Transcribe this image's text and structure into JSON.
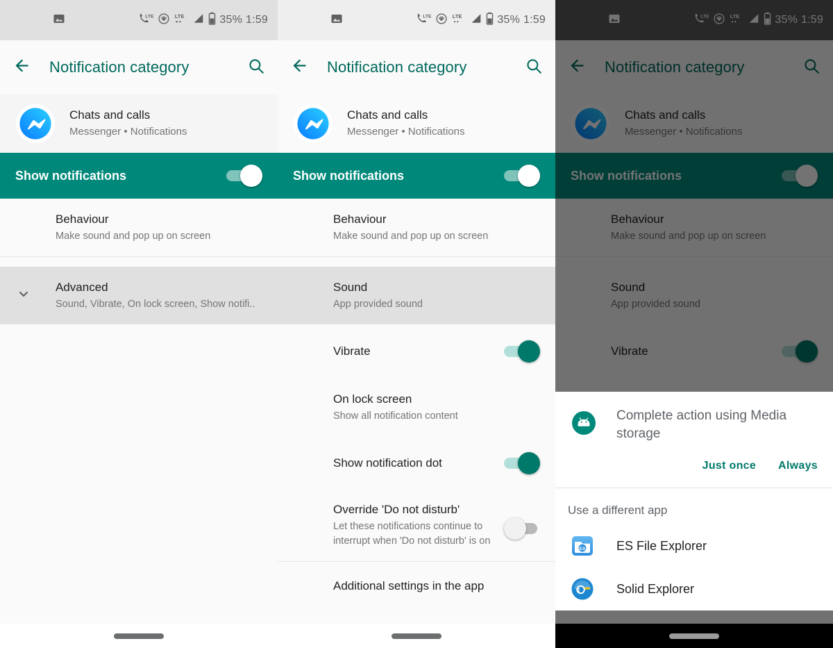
{
  "status_bar": {
    "icons": [
      "image-icon",
      "lte-call-icon",
      "hotspot-icon",
      "lte-data-icon",
      "signal-icon",
      "battery-icon"
    ],
    "battery": "35%",
    "time": "1:59"
  },
  "toolbar": {
    "title": "Notification category",
    "back_icon": "back-arrow-icon",
    "search_icon": "search-icon"
  },
  "app_header": {
    "icon": "messenger-icon",
    "title": "Chats and calls",
    "subtitle": "Messenger • Notifications"
  },
  "master_switch": {
    "label": "Show notifications",
    "state": "on"
  },
  "rows": {
    "behaviour": {
      "title": "Behaviour",
      "subtitle": "Make sound and pop up on screen"
    },
    "advanced": {
      "title": "Advanced",
      "subtitle": "Sound, Vibrate, On lock screen, Show notifi..",
      "chevron": "chevron-down-icon"
    },
    "sound": {
      "title": "Sound",
      "subtitle": "App provided sound"
    },
    "vibrate": {
      "title": "Vibrate",
      "state": "on"
    },
    "lock_screen": {
      "title": "On lock screen",
      "subtitle": "Show all notification content"
    },
    "notification_dot": {
      "title": "Show notification dot",
      "state": "on"
    },
    "override_dnd": {
      "title": "Override 'Do not disturb'",
      "subtitle": "Let these notifications continue to interrupt when 'Do not disturb' is on",
      "state": "off"
    },
    "additional_settings": {
      "title": "Additional settings in the app"
    }
  },
  "dialog": {
    "icon": "android-media-storage-icon",
    "title": "Complete action using Media storage",
    "just_once": "Just once",
    "always": "Always",
    "different_app_header": "Use a different app",
    "apps": [
      {
        "name": "ES File Explorer",
        "icon": "es-file-explorer-icon"
      },
      {
        "name": "Solid Explorer",
        "icon": "solid-explorer-icon"
      }
    ]
  },
  "colors": {
    "teal_primary": "#00897b",
    "teal_dark": "#00695c",
    "teal_toggle": "#00796b",
    "status_bar_bg": "#e0e0e0",
    "panel_bg": "#fafafa",
    "highlight_bg": "#e0e0e0"
  }
}
